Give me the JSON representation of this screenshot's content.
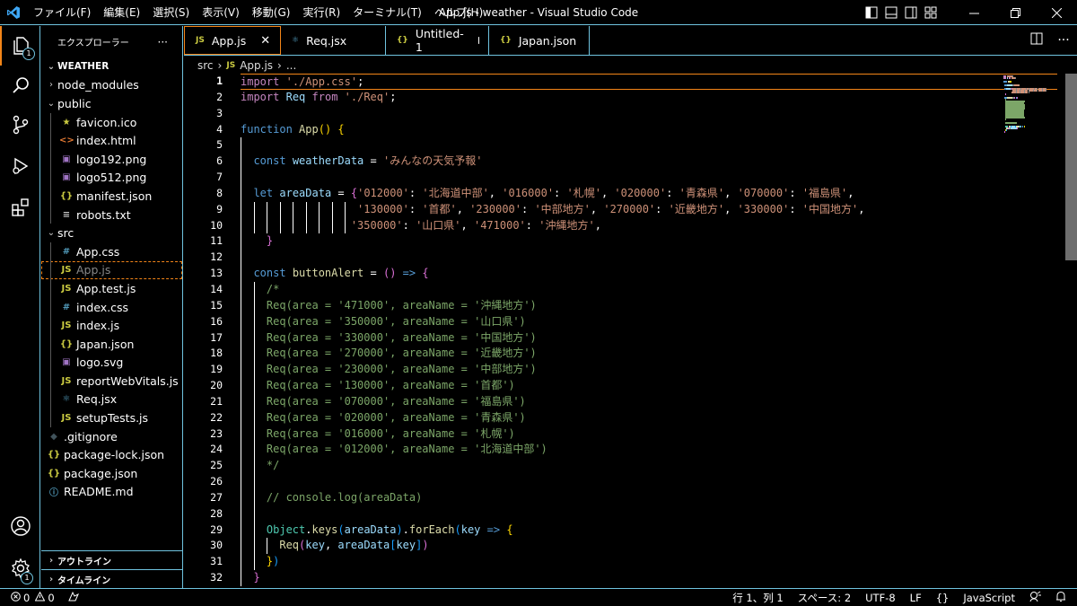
{
  "app": {
    "window_title": "App.js - weather - Visual Studio Code",
    "menu": [
      "ファイル(F)",
      "編集(E)",
      "選択(S)",
      "表示(V)",
      "移動(G)",
      "実行(R)",
      "ターミナル(T)",
      "ヘルプ(H)"
    ]
  },
  "activity": {
    "explorer_badge": "1",
    "settings_badge": "1"
  },
  "sidebar": {
    "title": "エクスプローラー",
    "more": "···",
    "project": "WEATHER",
    "tree": [
      {
        "label": "node_modules",
        "type": "folder",
        "depth": 1,
        "open": false
      },
      {
        "label": "public",
        "type": "folder",
        "depth": 1,
        "open": true
      },
      {
        "label": "favicon.ico",
        "type": "ico",
        "depth": 2
      },
      {
        "label": "index.html",
        "type": "html",
        "depth": 2
      },
      {
        "label": "logo192.png",
        "type": "png",
        "depth": 2
      },
      {
        "label": "logo512.png",
        "type": "png",
        "depth": 2
      },
      {
        "label": "manifest.json",
        "type": "json",
        "depth": 2
      },
      {
        "label": "robots.txt",
        "type": "txt",
        "depth": 2
      },
      {
        "label": "src",
        "type": "folder",
        "depth": 1,
        "open": true
      },
      {
        "label": "App.css",
        "type": "css",
        "depth": 2
      },
      {
        "label": "App.js",
        "type": "js",
        "depth": 2,
        "selected": true
      },
      {
        "label": "App.test.js",
        "type": "js",
        "depth": 2
      },
      {
        "label": "index.css",
        "type": "css",
        "depth": 2
      },
      {
        "label": "index.js",
        "type": "js",
        "depth": 2
      },
      {
        "label": "Japan.json",
        "type": "json",
        "depth": 2
      },
      {
        "label": "logo.svg",
        "type": "svg",
        "depth": 2
      },
      {
        "label": "reportWebVitals.js",
        "type": "js",
        "depth": 2
      },
      {
        "label": "Req.jsx",
        "type": "jsx",
        "depth": 2
      },
      {
        "label": "setupTests.js",
        "type": "js",
        "depth": 2
      },
      {
        "label": ".gitignore",
        "type": "git",
        "depth": 1
      },
      {
        "label": "package-lock.json",
        "type": "json",
        "depth": 1
      },
      {
        "label": "package.json",
        "type": "json",
        "depth": 1
      },
      {
        "label": "README.md",
        "type": "md",
        "depth": 1
      }
    ],
    "outline": "アウトライン",
    "timeline": "タイムライン"
  },
  "tabs": [
    {
      "label": "App.js",
      "icon": "JS",
      "active": true,
      "state": "close"
    },
    {
      "label": "Req.jsx",
      "icon": "jsx",
      "active": false,
      "state": ""
    },
    {
      "label": "Untitled-1",
      "icon": "{}",
      "active": false,
      "state": "dirty"
    },
    {
      "label": "Japan.json",
      "icon": "{}",
      "active": false,
      "state": ""
    }
  ],
  "breadcrumb": {
    "folder": "src",
    "file_icon": "JS",
    "file": "App.js",
    "symbol": "..."
  },
  "editor": {
    "current_line": 1,
    "lines": [
      [
        [
          "kc",
          "import"
        ],
        [
          "pn",
          " "
        ],
        [
          "str",
          "'./App.css'"
        ],
        [
          "pn",
          ";"
        ]
      ],
      [
        [
          "kc",
          "import"
        ],
        [
          "pn",
          " "
        ],
        [
          "var",
          "Req"
        ],
        [
          "pn",
          " "
        ],
        [
          "kc",
          "from"
        ],
        [
          "pn",
          " "
        ],
        [
          "str",
          "'./Req'"
        ],
        [
          "pn",
          ";"
        ]
      ],
      [],
      [
        [
          "kw",
          "function"
        ],
        [
          "pn",
          " "
        ],
        [
          "fn",
          "App"
        ],
        [
          "br1",
          "()"
        ],
        [
          "pn",
          " "
        ],
        [
          "br1",
          "{"
        ]
      ],
      [],
      [
        [
          "pn",
          "  "
        ],
        [
          "kw",
          "const"
        ],
        [
          "pn",
          " "
        ],
        [
          "var",
          "weatherData"
        ],
        [
          "pn",
          " = "
        ],
        [
          "str",
          "'みんなの天気予報'"
        ]
      ],
      [],
      [
        [
          "pn",
          "  "
        ],
        [
          "kw",
          "let"
        ],
        [
          "pn",
          " "
        ],
        [
          "var",
          "areaData"
        ],
        [
          "pn",
          " = "
        ],
        [
          "br2",
          "{"
        ],
        [
          "str",
          "'012000'"
        ],
        [
          "pn",
          ": "
        ],
        [
          "str",
          "'北海道中部'"
        ],
        [
          "pn",
          ", "
        ],
        [
          "str",
          "'016000'"
        ],
        [
          "pn",
          ": "
        ],
        [
          "str",
          "'札幌'"
        ],
        [
          "pn",
          ", "
        ],
        [
          "str",
          "'020000'"
        ],
        [
          "pn",
          ": "
        ],
        [
          "str",
          "'青森県'"
        ],
        [
          "pn",
          ", "
        ],
        [
          "str",
          "'070000'"
        ],
        [
          "pn",
          ": "
        ],
        [
          "str",
          "'福島県'"
        ],
        [
          "pn",
          ","
        ]
      ],
      [
        [
          "pn",
          "                  "
        ],
        [
          "str",
          "'130000'"
        ],
        [
          "pn",
          ": "
        ],
        [
          "str",
          "'首都'"
        ],
        [
          "pn",
          ", "
        ],
        [
          "str",
          "'230000'"
        ],
        [
          "pn",
          ": "
        ],
        [
          "str",
          "'中部地方'"
        ],
        [
          "pn",
          ", "
        ],
        [
          "str",
          "'270000'"
        ],
        [
          "pn",
          ": "
        ],
        [
          "str",
          "'近畿地方'"
        ],
        [
          "pn",
          ", "
        ],
        [
          "str",
          "'330000'"
        ],
        [
          "pn",
          ": "
        ],
        [
          "str",
          "'中国地方'"
        ],
        [
          "pn",
          ","
        ]
      ],
      [
        [
          "pn",
          "                 "
        ],
        [
          "str",
          "'350000'"
        ],
        [
          "pn",
          ": "
        ],
        [
          "str",
          "'山口県'"
        ],
        [
          "pn",
          ", "
        ],
        [
          "str",
          "'471000'"
        ],
        [
          "pn",
          ": "
        ],
        [
          "str",
          "'沖縄地方'"
        ],
        [
          "pn",
          ","
        ]
      ],
      [
        [
          "pn",
          "    "
        ],
        [
          "br2",
          "}"
        ]
      ],
      [],
      [
        [
          "pn",
          "  "
        ],
        [
          "kw",
          "const"
        ],
        [
          "pn",
          " "
        ],
        [
          "fn",
          "buttonAlert"
        ],
        [
          "pn",
          " = "
        ],
        [
          "br2",
          "()"
        ],
        [
          "pn",
          " "
        ],
        [
          "kw",
          "=>"
        ],
        [
          "pn",
          " "
        ],
        [
          "br2",
          "{"
        ]
      ],
      [
        [
          "pn",
          "    "
        ],
        [
          "cm",
          "/*"
        ]
      ],
      [
        [
          "pn",
          "    "
        ],
        [
          "cm",
          "Req(area = '471000', areaName = '沖縄地方')"
        ]
      ],
      [
        [
          "pn",
          "    "
        ],
        [
          "cm",
          "Req(area = '350000', areaName = '山口県')"
        ]
      ],
      [
        [
          "pn",
          "    "
        ],
        [
          "cm",
          "Req(area = '330000', areaName = '中国地方')"
        ]
      ],
      [
        [
          "pn",
          "    "
        ],
        [
          "cm",
          "Req(area = '270000', areaName = '近畿地方')"
        ]
      ],
      [
        [
          "pn",
          "    "
        ],
        [
          "cm",
          "Req(area = '230000', areaName = '中部地方')"
        ]
      ],
      [
        [
          "pn",
          "    "
        ],
        [
          "cm",
          "Req(area = '130000', areaName = '首都')"
        ]
      ],
      [
        [
          "pn",
          "    "
        ],
        [
          "cm",
          "Req(area = '070000', areaName = '福島県')"
        ]
      ],
      [
        [
          "pn",
          "    "
        ],
        [
          "cm",
          "Req(area = '020000', areaName = '青森県')"
        ]
      ],
      [
        [
          "pn",
          "    "
        ],
        [
          "cm",
          "Req(area = '016000', areaName = '札幌')"
        ]
      ],
      [
        [
          "pn",
          "    "
        ],
        [
          "cm",
          "Req(area = '012000', areaName = '北海道中部')"
        ]
      ],
      [
        [
          "pn",
          "    "
        ],
        [
          "cm",
          "*/"
        ]
      ],
      [],
      [
        [
          "pn",
          "    "
        ],
        [
          "cm",
          "// console.log(areaData)"
        ]
      ],
      [],
      [
        [
          "pn",
          "    "
        ],
        [
          "cls",
          "Object"
        ],
        [
          "pn",
          "."
        ],
        [
          "fn",
          "keys"
        ],
        [
          "br3",
          "("
        ],
        [
          "var",
          "areaData"
        ],
        [
          "br3",
          ")"
        ],
        [
          "pn",
          "."
        ],
        [
          "fn",
          "forEach"
        ],
        [
          "br3",
          "("
        ],
        [
          "var",
          "key"
        ],
        [
          "pn",
          " "
        ],
        [
          "kw",
          "=>"
        ],
        [
          "pn",
          " "
        ],
        [
          "br1",
          "{"
        ]
      ],
      [
        [
          "pn",
          "      "
        ],
        [
          "fn",
          "Req"
        ],
        [
          "br2",
          "("
        ],
        [
          "var",
          "key"
        ],
        [
          "pn",
          ", "
        ],
        [
          "var",
          "areaData"
        ],
        [
          "br3",
          "["
        ],
        [
          "var",
          "key"
        ],
        [
          "br3",
          "]"
        ],
        [
          "br2",
          ")"
        ]
      ],
      [
        [
          "pn",
          "    "
        ],
        [
          "br1",
          "}"
        ],
        [
          "br3",
          ")"
        ]
      ],
      [
        [
          "pn",
          "  "
        ],
        [
          "br2",
          "}"
        ]
      ]
    ]
  },
  "statusbar": {
    "errors": "0",
    "warnings": "0",
    "position": "行 1、列 1",
    "spaces": "スペース: 2",
    "encoding": "UTF-8",
    "eol": "LF",
    "braces": "{}",
    "language": "JavaScript"
  },
  "colors": {
    "contrast_border": "#6fc3df",
    "active_border": "#f38518",
    "js_icon": "#cbcb41",
    "json_icon": "#cbcb41",
    "css_icon": "#519aba",
    "html_icon": "#e37933",
    "png_icon": "#a074c4"
  }
}
